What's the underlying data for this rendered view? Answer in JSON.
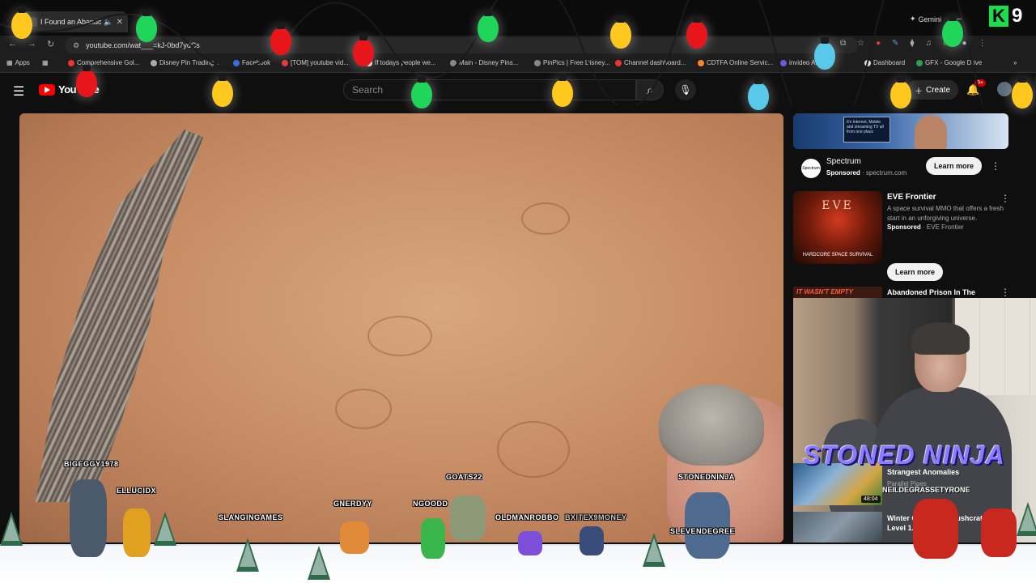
{
  "browser": {
    "tab_title": "I Found an Abandoned",
    "gemini_label": "Gemini",
    "url": "youtube.com/wat___=kJ-0bd7ydCs",
    "bookmarks": [
      {
        "label": "Apps"
      },
      {
        "label": "Comprehensive Gol..."
      },
      {
        "label": "Disney Pin Trading..."
      },
      {
        "label": "Facebook"
      },
      {
        "label": "[TOM] youtube vid..."
      },
      {
        "label": "If todays people we..."
      },
      {
        "label": "Main - Disney Pins..."
      },
      {
        "label": "PinPics | Free Disney..."
      },
      {
        "label": "Channel dashboard..."
      },
      {
        "label": "CDTFA Online Servic..."
      },
      {
        "label": "invideo AI..."
      },
      {
        "label": "Dashboard"
      },
      {
        "label": "GFX - Google Drive"
      }
    ],
    "k9_letter": "K",
    "k9_number": "9"
  },
  "youtube": {
    "logo_text": "YouTube",
    "search_placeholder": "Search",
    "create_label": "Create",
    "notif_badge": "9+"
  },
  "sidebar": {
    "ad1": {
      "title": "Spectrum",
      "sponsored": "Sponsored",
      "domain": "spectrum.com",
      "button": "Learn more",
      "logo_text": "Spectrum",
      "tv_text": "It's Internet, Mobile and streaming TV all from one place"
    },
    "ad2": {
      "title": "EVE Frontier",
      "description": "A space survival MMO that offers a fresh start in an unforgiving universe.",
      "sponsored": "Sponsored",
      "advertiser": "EVE Frontier",
      "button": "Learn more",
      "thumb_logo": "EVE",
      "thumb_caption": "HARDCORE SPACE SURVIVAL"
    },
    "rec1": {
      "thumb_text": "IT WASN'T EMPTY",
      "title": "Abandoned Prison In The"
    },
    "rec2": {
      "title": "Strangest Anomalies",
      "channel": "Parallel Pipes",
      "duration": "48:04"
    },
    "rec3": {
      "title": "Winter C... Raised Bushcrat... Level 1..."
    }
  },
  "overlay": {
    "streamer_name": "STONED NINJA",
    "chat_user_bottom": "NEILDEGRASSETYRONE",
    "users": [
      "BIGEGGY1978",
      "ELLUCIDX",
      "SLANGINGAMES",
      "GNERDYY",
      "NGOODD",
      "GOATS22",
      "OLDMANROBBO",
      "BXITEX9MONEY",
      "STONEDNINJA",
      "SLEVENDEGREE"
    ]
  },
  "colors": {
    "bulb_red": "#e8161b",
    "bulb_green": "#1fd65a",
    "bulb_yellow": "#ffc81e",
    "bulb_blue": "#58c9e8",
    "youtube_red": "#ff0000",
    "k9_green": "#19e04a"
  }
}
